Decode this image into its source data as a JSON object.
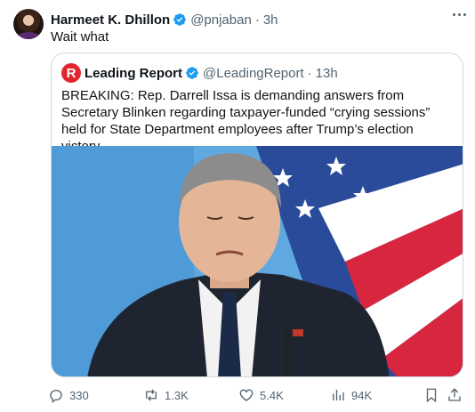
{
  "post": {
    "author_name": "Harmeet K. Dhillon",
    "author_handle": "@pnjaban",
    "separator": "·",
    "time": "3h",
    "text": "Wait what"
  },
  "quote": {
    "logo_letter": "R",
    "author_name": "Leading Report",
    "author_handle": "@LeadingReport",
    "separator": "·",
    "time": "13h",
    "text": "BREAKING: Rep. Darrell Issa is demanding answers from Secretary Blinken regarding taxpayer-funded “crying sessions” held for State Department employees after Trump’s election victory."
  },
  "actions": {
    "replies": "330",
    "reposts": "1.3K",
    "likes": "5.4K",
    "views": "94K"
  },
  "colors": {
    "verified": "#1d9bf0",
    "secondary_text": "#536471",
    "logo_red": "#e3262e",
    "border": "#cfd9de"
  },
  "icons": [
    "verified-badge-icon",
    "more-icon",
    "reply-icon",
    "repost-icon",
    "like-icon",
    "views-icon",
    "bookmark-icon",
    "share-icon"
  ]
}
